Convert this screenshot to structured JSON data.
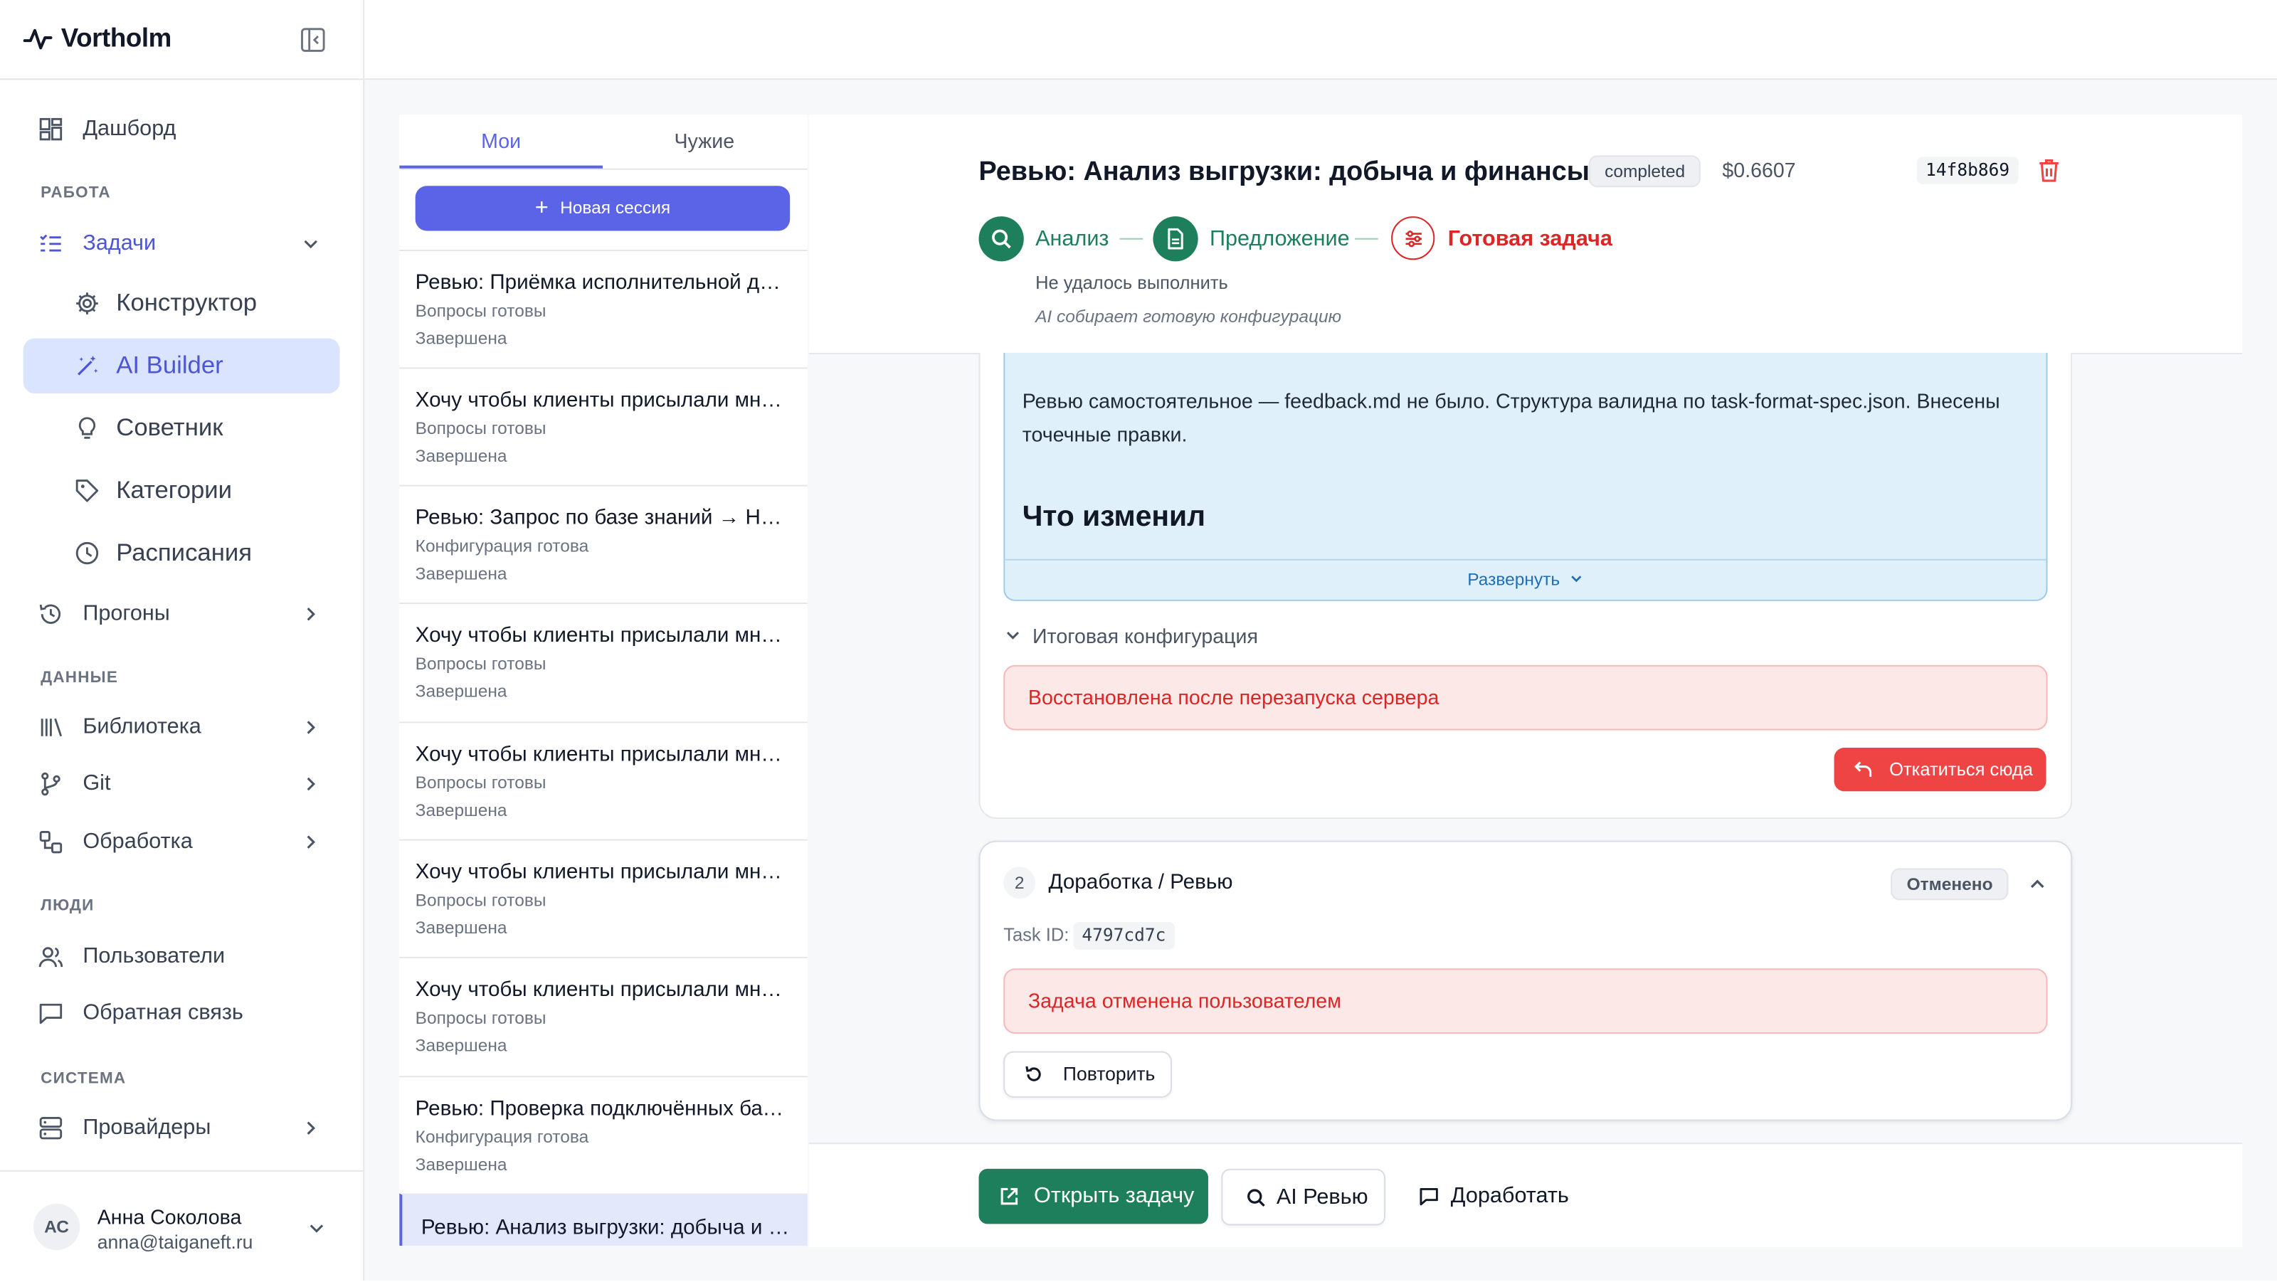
{
  "app": {
    "name": "Vortholm"
  },
  "sidebar": {
    "dashboard": "Дашборд",
    "sections": {
      "work": "РАБОТА",
      "data": "ДАННЫЕ",
      "people": "ЛЮДИ",
      "system": "СИСТЕМА"
    },
    "tasks": "Задачи",
    "constructor": "Конструктор",
    "ai_builder": "AI Builder",
    "advisor": "Советник",
    "categories": "Категории",
    "schedules": "Расписания",
    "runs": "Прогоны",
    "library": "Библиотека",
    "git": "Git",
    "processing": "Обработка",
    "users": "Пользователи",
    "feedback": "Обратная связь",
    "providers": "Провайдеры",
    "user": {
      "initials": "АС",
      "name": "Анна Соколова",
      "email": "anna@taiganeft.ru"
    }
  },
  "sessions": {
    "tabs": [
      "Мои",
      "Чужие"
    ],
    "new_session": "Новая сессия",
    "items": [
      {
        "title": "Ревью: Приёмка исполнительной до…",
        "stage": "Вопросы готовы",
        "status": "Завершена"
      },
      {
        "title": "Хочу чтобы клиенты присылали мне …",
        "stage": "Вопросы готовы",
        "status": "Завершена"
      },
      {
        "title": "Ревью: Запрос по базе знаний → HTM…",
        "stage": "Конфигурация готова",
        "status": "Завершена"
      },
      {
        "title": "Хочу чтобы клиенты присылали мне …",
        "stage": "Вопросы готовы",
        "status": "Завершена"
      },
      {
        "title": "Хочу чтобы клиенты присылали мне …",
        "stage": "Вопросы готовы",
        "status": "Завершена"
      },
      {
        "title": "Хочу чтобы клиенты присылали мне …",
        "stage": "Вопросы готовы",
        "status": "Завершена"
      },
      {
        "title": "Хочу чтобы клиенты присылали мне …",
        "stage": "Вопросы готовы",
        "status": "Завершена"
      },
      {
        "title": "Ревью: Проверка подключённых баз …",
        "stage": "Конфигурация готова",
        "status": "Завершена"
      },
      {
        "title": "Ревью: Анализ выгрузки: добыча и ф…",
        "stage": "",
        "status": ""
      }
    ]
  },
  "main": {
    "title": "Ревью: Анализ выгрузки: добыча и финансы",
    "status_badge": "completed",
    "cost": "$0.6607",
    "hash": "14f8b869",
    "steps": [
      "Анализ",
      "Предложение",
      "Готовая задача"
    ],
    "step_note": "Не удалось выполнить",
    "step_subnote": "AI собирает готовую конфигурацию",
    "card1": {
      "text": "Ревью самостоятельное — feedback.md не было. Структура валидна по task-format-spec.json. Внесены точечные правки.",
      "heading": "Что изменил",
      "expand": "Развернуть",
      "config_toggle": "Итоговая конфигурация",
      "error": "Восстановлена после перезапуска сервера",
      "rollback": "Откатиться сюда"
    },
    "card2": {
      "number": "2",
      "title": "Доработка / Ревью",
      "badge": "Отменено",
      "task_id_label": "Task ID:",
      "task_id": "4797cd7c",
      "error": "Задача отменена пользователем",
      "retry": "Повторить"
    },
    "footer": {
      "open_task": "Открыть задачу",
      "ai_review": "AI Ревью",
      "improve": "Доработать"
    }
  },
  "colors": {
    "accent": "#5b63e6",
    "success": "#1e7f5c",
    "danger": "#ef4444",
    "active_nav_bg": "#dbe4ff"
  }
}
